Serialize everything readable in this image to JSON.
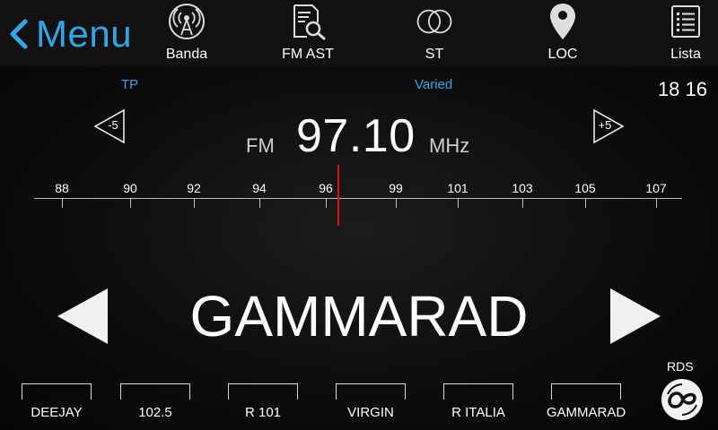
{
  "topbar": {
    "menu_label": "Menu",
    "menu_icon": "chevron-left-icon",
    "accent_color": "#2ea7e6",
    "buttons": [
      {
        "label": "Banda",
        "icon": "radio-tower-icon"
      },
      {
        "label": "FM AST",
        "icon": "document-search-icon"
      },
      {
        "label": "ST",
        "icon": "stereo-circles-icon"
      },
      {
        "label": "LOC",
        "icon": "location-pin-icon"
      },
      {
        "label": "Lista",
        "icon": "list-icon"
      }
    ]
  },
  "status": {
    "tp": "TP",
    "pty": "Varied",
    "clock": "18 16"
  },
  "tuner": {
    "seek_down": "-5",
    "seek_up": "+5",
    "band": "FM",
    "frequency": "97.10",
    "unit": "MHz",
    "needle_color": "#e01010"
  },
  "scale": {
    "labels": [
      "88",
      "90",
      "92",
      "94",
      "96",
      "99",
      "101",
      "103",
      "105",
      "107"
    ]
  },
  "station": {
    "name": "GAMMARAD"
  },
  "presets": [
    "DEEJAY",
    "102.5",
    "R 101",
    "VIRGIN",
    "R ITALIA",
    "GAMMARAD"
  ],
  "rds": {
    "label": "RDS",
    "icon": "rds-logo-icon"
  }
}
